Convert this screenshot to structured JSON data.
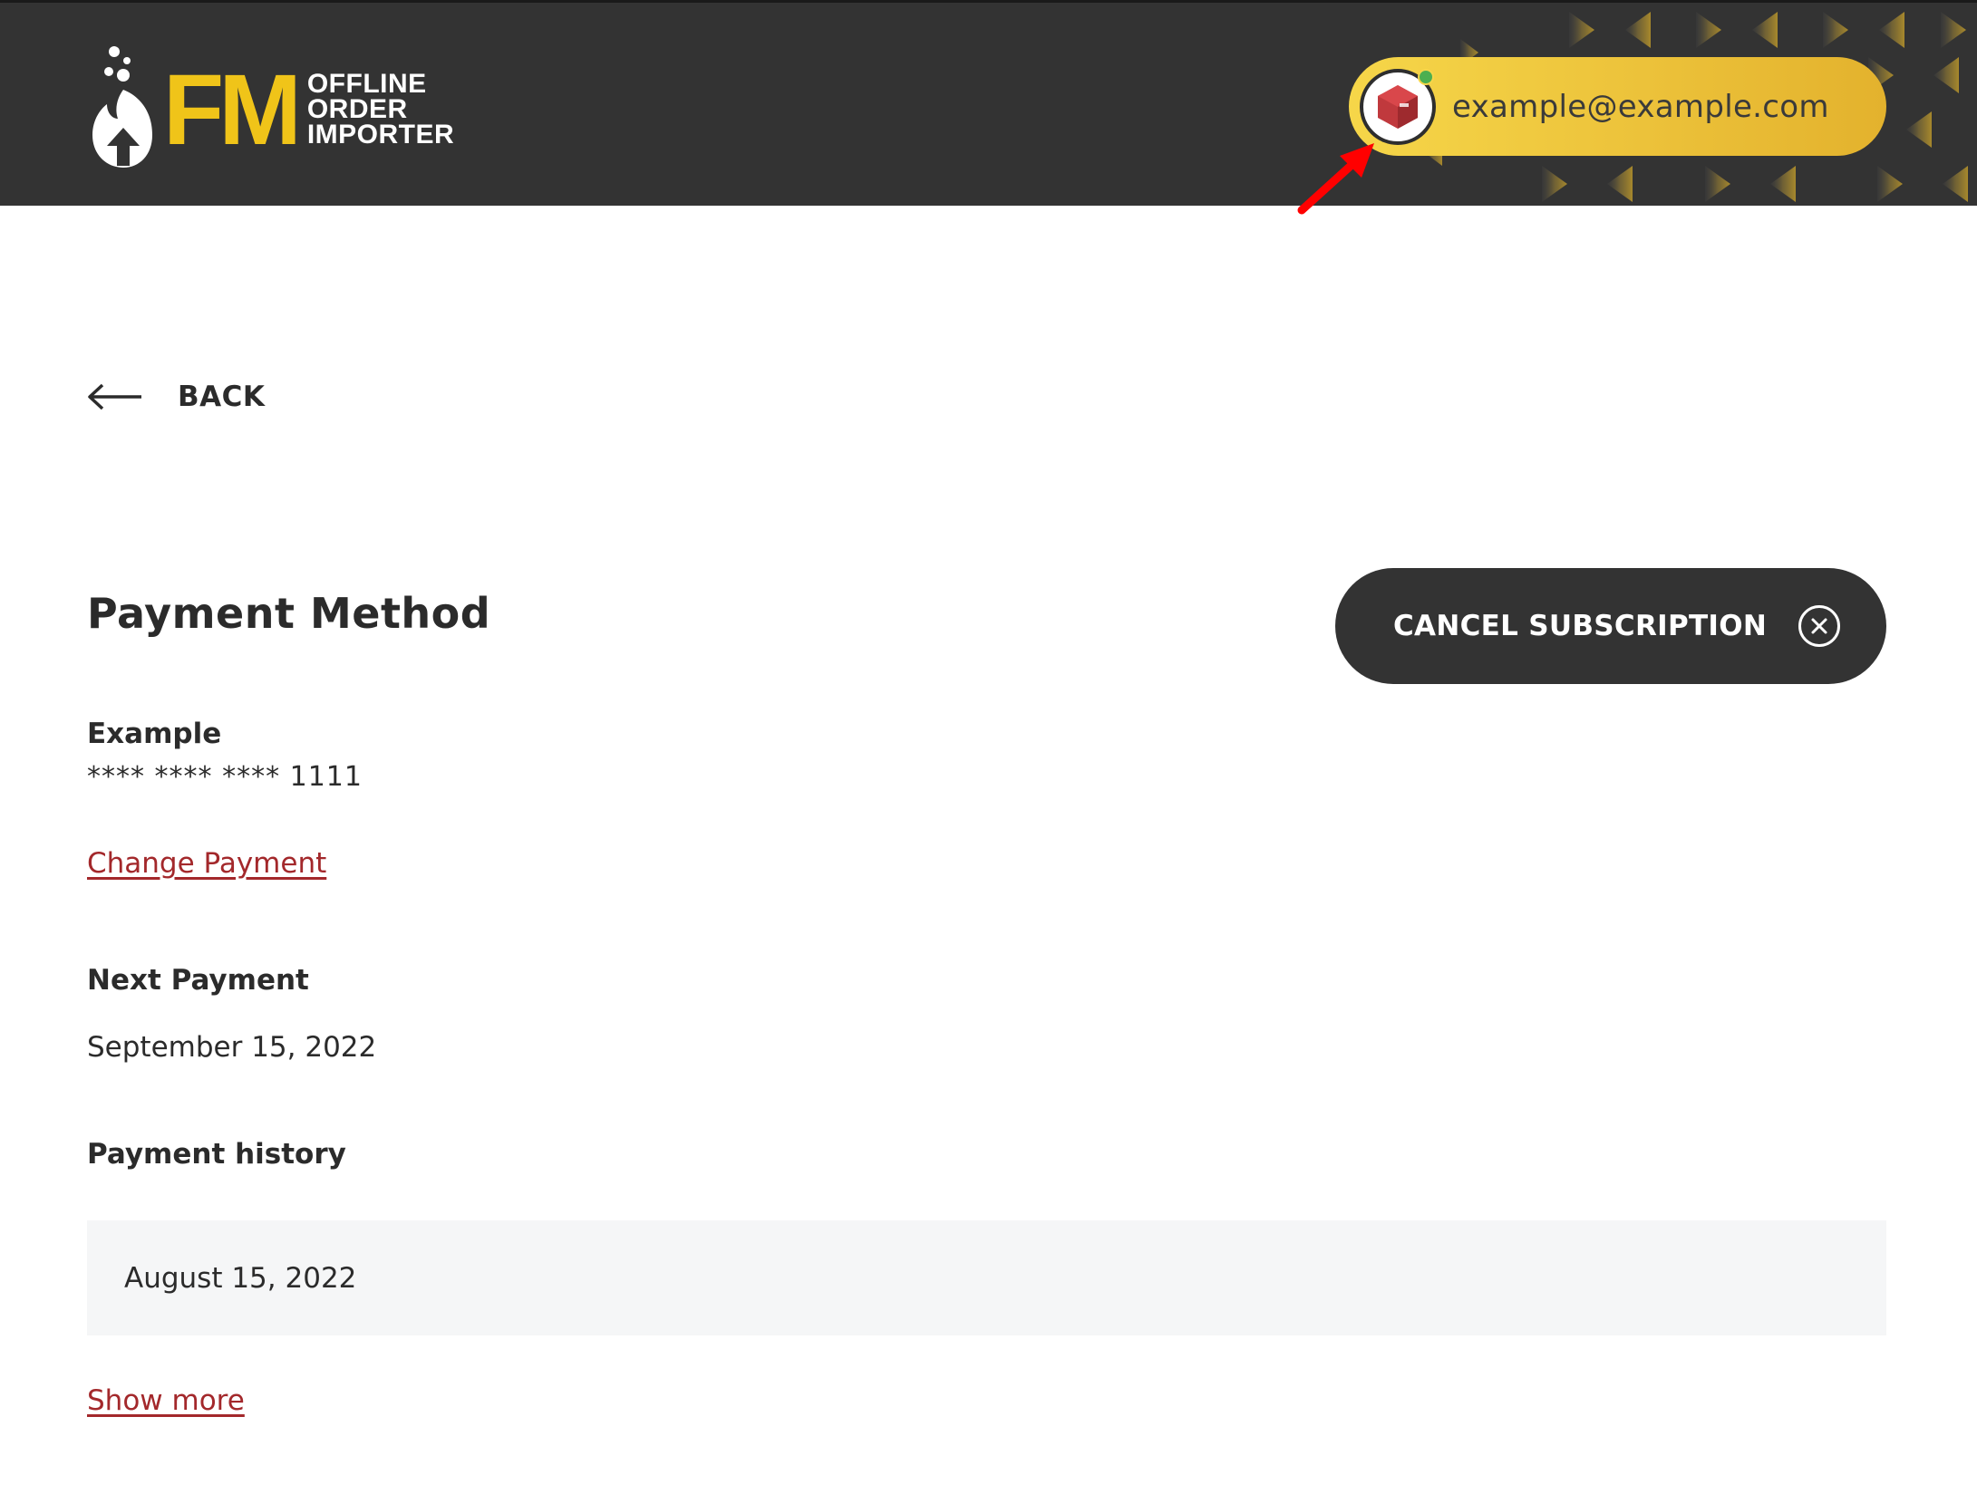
{
  "brand": {
    "logo_letters": "FM",
    "logo_line1": "OFFLINE",
    "logo_line2": "ORDER",
    "logo_line3": "IMPORTER",
    "accent_color": "#f0c419",
    "header_bg": "#333333"
  },
  "account": {
    "email": "example@example.com",
    "avatar_icon": "red-cube-icon",
    "status_color": "#4caf50"
  },
  "nav": {
    "back_label": "BACK"
  },
  "payment_method": {
    "title": "Payment Method",
    "card_name": "Example",
    "card_number": "**** **** **** 1111",
    "change_link": "Change Payment"
  },
  "subscription": {
    "cancel_label": "CANCEL SUBSCRIPTION"
  },
  "next_payment": {
    "label": "Next Payment",
    "date": "September 15, 2022"
  },
  "payment_history": {
    "label": "Payment history",
    "items": [
      {
        "date": "August 15, 2022"
      }
    ],
    "show_more_label": "Show more"
  },
  "colors": {
    "link_red": "#a3282b",
    "pill_gold": "#ecc23a",
    "button_dark": "#333333"
  }
}
